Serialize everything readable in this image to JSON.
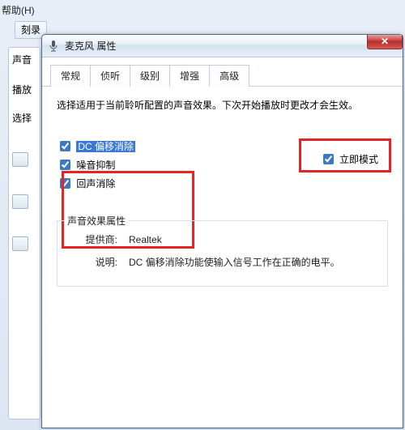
{
  "menubar": {
    "help": "帮助(H)"
  },
  "toolbar": {
    "burn": "刻录"
  },
  "backWindow": {
    "soundHeading": "声音",
    "playbackLabel": "播放",
    "selectLabel": "选择"
  },
  "dialog": {
    "title": "麦克风 属性",
    "closeGlyph": "✕",
    "tabs": {
      "general": "常规",
      "listen": "侦听",
      "levels": "级别",
      "enhancements": "增强",
      "advanced": "高级"
    },
    "instruction": "选择适用于当前聆听配置的声音效果。下次开始播放时更改才会生效。",
    "immediateMode": {
      "label": "立即模式",
      "checked": true
    },
    "effects": {
      "dcOffset": {
        "label": "DC 偏移消除",
        "checked": true,
        "selected": true
      },
      "noiseSuppress": {
        "label": "噪音抑制",
        "checked": true
      },
      "echoCancel": {
        "label": "回声消除",
        "checked": true
      }
    },
    "props": {
      "legend": "声音效果属性",
      "providerLabel": "提供商:",
      "providerValue": "Realtek",
      "descLabel": "说明:",
      "descValue": "DC 偏移消除功能使输入信号工作在正确的电平。"
    }
  }
}
